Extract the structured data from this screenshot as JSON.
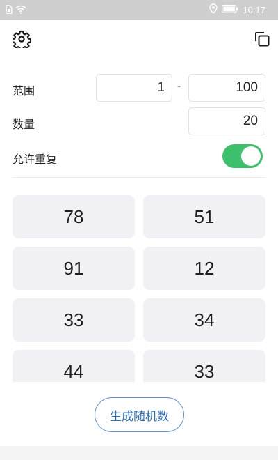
{
  "status_bar": {
    "time": "10:17",
    "icons": [
      "sim-icon",
      "wifi-icon",
      "location-icon",
      "battery-icon"
    ]
  },
  "toolbar": {
    "settings_icon": "gear-icon",
    "copy_icon": "copy-icon"
  },
  "form": {
    "range_label": "范围",
    "range_min": "1",
    "range_separator": "-",
    "range_max": "100",
    "count_label": "数量",
    "count_value": "20",
    "allow_repeat_label": "允许重复",
    "allow_repeat_on": true
  },
  "results": [
    "78",
    "51",
    "91",
    "12",
    "33",
    "34",
    "44",
    "33"
  ],
  "actions": {
    "generate_label": "生成随机数"
  },
  "colors": {
    "toggle_on": "#3cc06c",
    "button_border": "#5b8fd0",
    "button_text": "#2f6fb8",
    "cell_bg": "#f1f1f5"
  }
}
